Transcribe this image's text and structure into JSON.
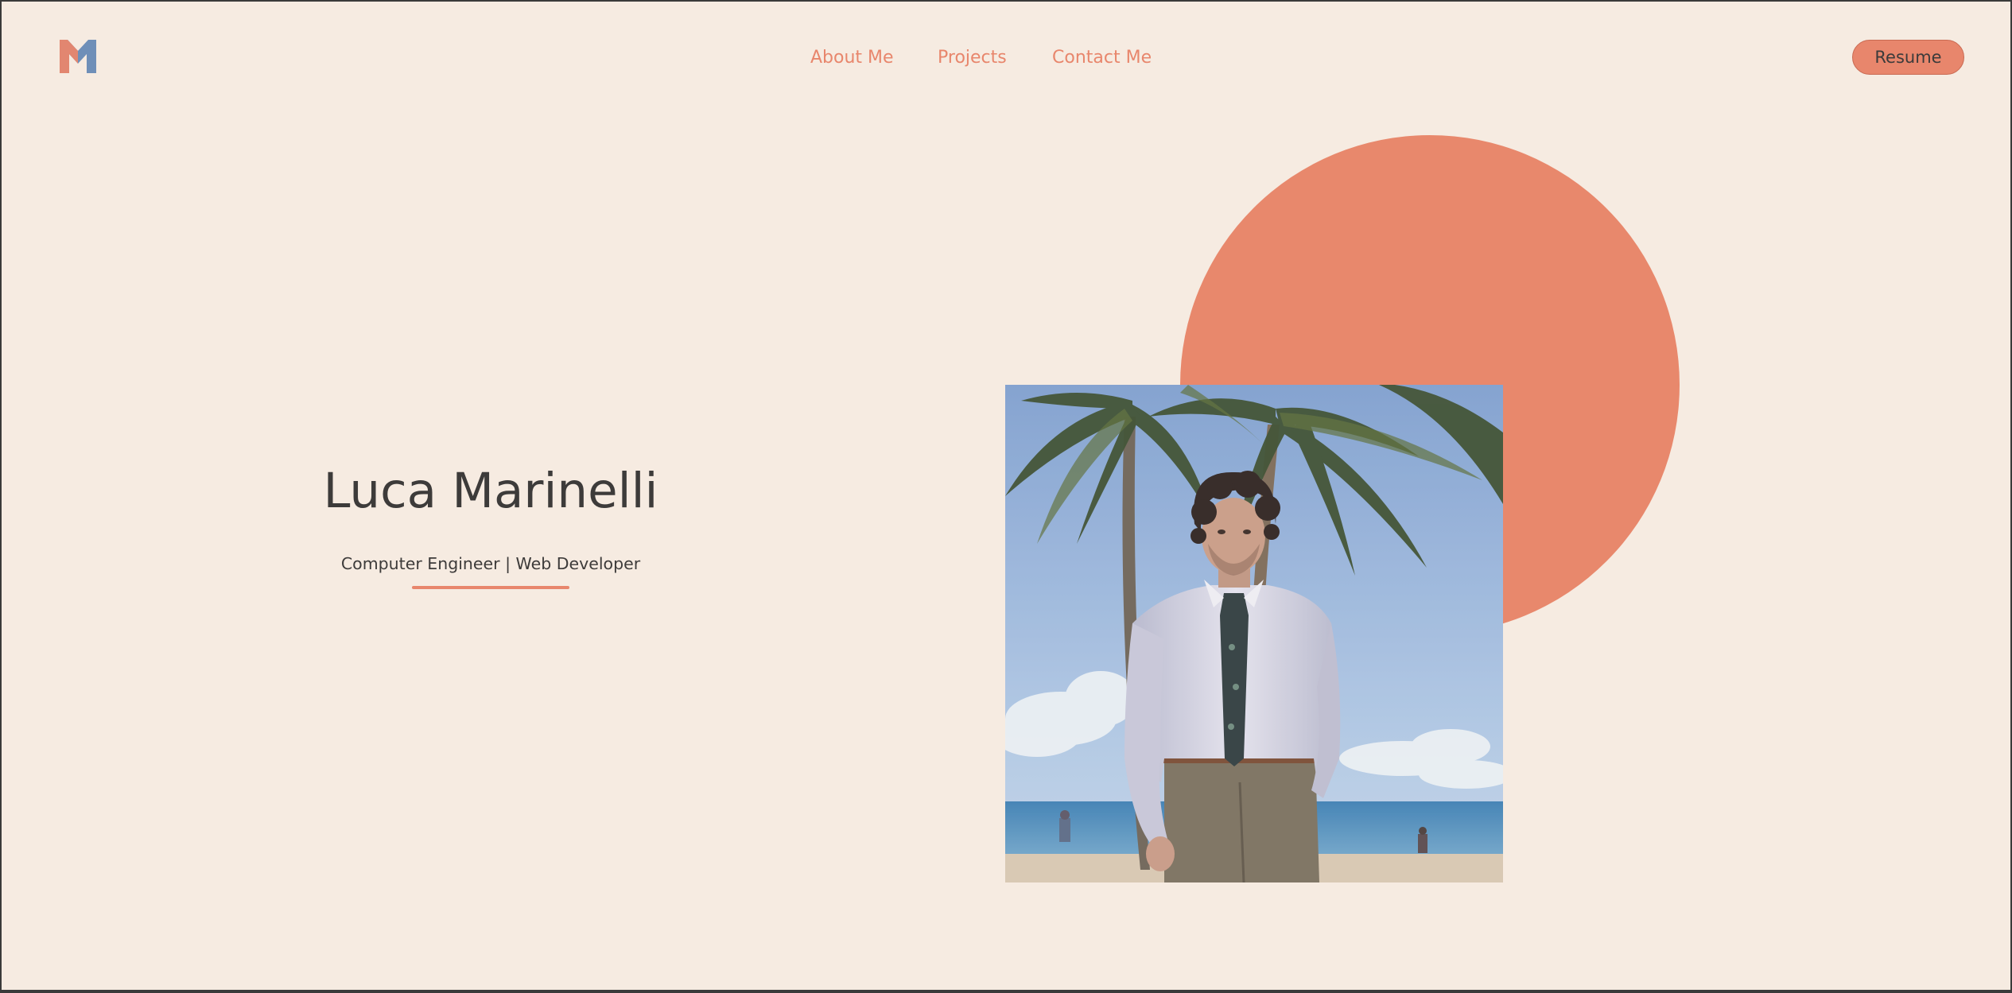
{
  "header": {
    "logo_icon": "m-monogram-logo-icon",
    "nav": [
      {
        "label": "About Me"
      },
      {
        "label": "Projects"
      },
      {
        "label": "Contact Me"
      }
    ],
    "resume_label": "Resume"
  },
  "hero": {
    "name": "Luca Marinelli",
    "subtitle": "Computer Engineer | Web Developer",
    "photo_icon": "portrait-photo"
  },
  "colors": {
    "background": "#f6ebe1",
    "accent": "#e8866c",
    "text": "#3d3b3a",
    "logo_blue": "#6f8fb8"
  }
}
